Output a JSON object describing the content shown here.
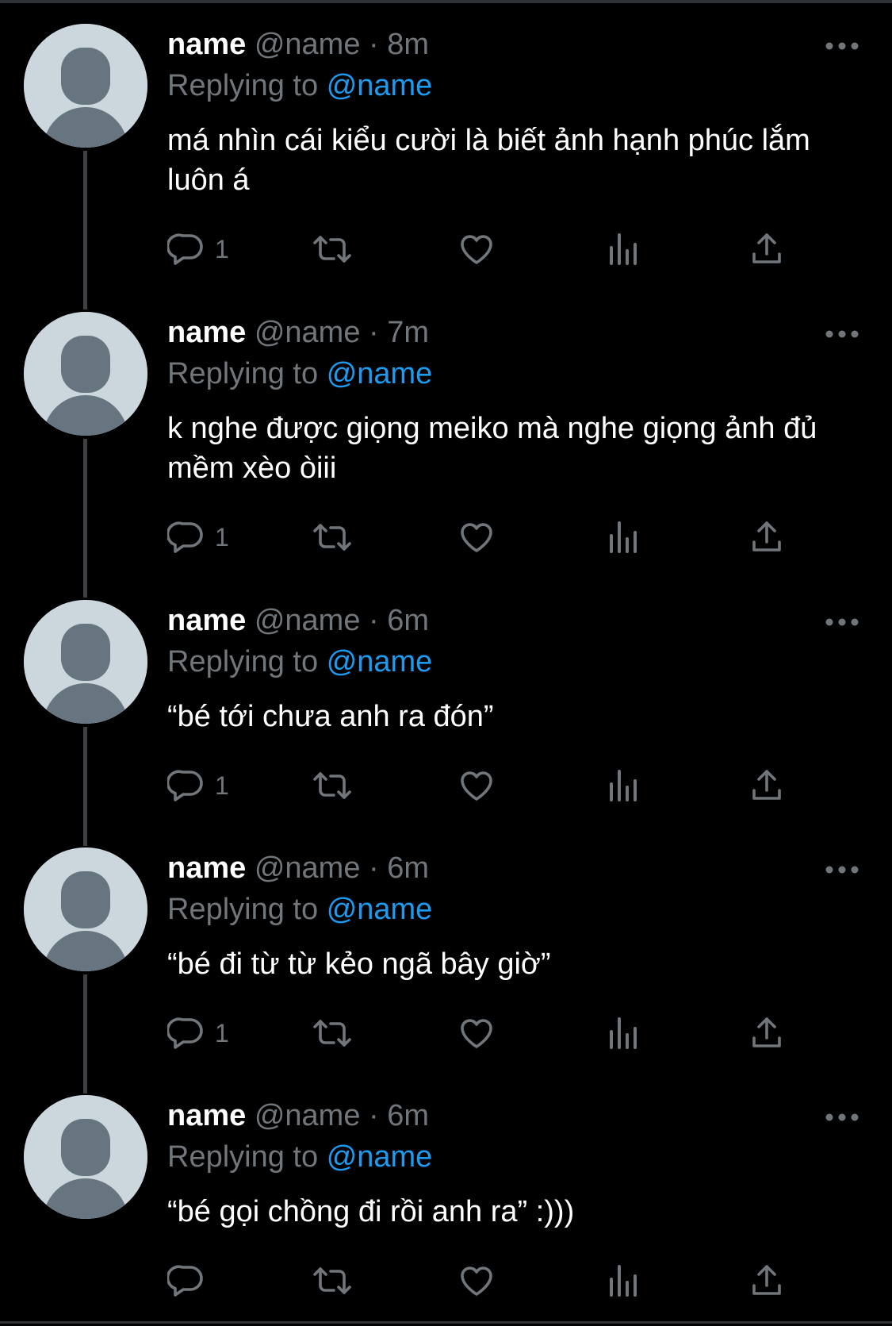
{
  "colors": {
    "background": "#000000",
    "text_primary": "#ffffff",
    "text_secondary": "#71767b",
    "accent_link": "#1d9bf0",
    "avatar_bg": "#ccd6dd",
    "avatar_figure": "#66757f",
    "thread_line": "#3e4144"
  },
  "icons": {
    "more": "more-horizontal-icon",
    "reply": "reply-bubble-icon",
    "retweet": "retweet-icon",
    "like": "heart-icon",
    "views": "analytics-bars-icon",
    "share": "share-upload-icon"
  },
  "tweets": [
    {
      "display_name": "name",
      "handle": "@name",
      "separator": "·",
      "time": "8m",
      "replying_prefix": "Replying to",
      "replying_to": "@name",
      "text": "má nhìn cái kiểu cười là biết ảnh hạnh phúc lắm luôn á",
      "reply_count": "1"
    },
    {
      "display_name": "name",
      "handle": "@name",
      "separator": "·",
      "time": "7m",
      "replying_prefix": "Replying to",
      "replying_to": "@name",
      "text": "k nghe được giọng meiko mà nghe giọng ảnh đủ mềm xèo òiii",
      "reply_count": "1"
    },
    {
      "display_name": "name",
      "handle": "@name",
      "separator": "·",
      "time": "6m",
      "replying_prefix": "Replying to",
      "replying_to": "@name",
      "text": "“bé tới chưa anh ra đón”",
      "reply_count": "1"
    },
    {
      "display_name": "name",
      "handle": "@name",
      "separator": "·",
      "time": "6m",
      "replying_prefix": "Replying to",
      "replying_to": "@name",
      "text": "“bé đi từ từ kẻo ngã bây giờ”",
      "reply_count": "1"
    },
    {
      "display_name": "name",
      "handle": "@name",
      "separator": "·",
      "time": "6m",
      "replying_prefix": "Replying to",
      "replying_to": "@name",
      "text": "“bé gọi chồng đi rồi anh ra” :)))",
      "reply_count": ""
    }
  ]
}
